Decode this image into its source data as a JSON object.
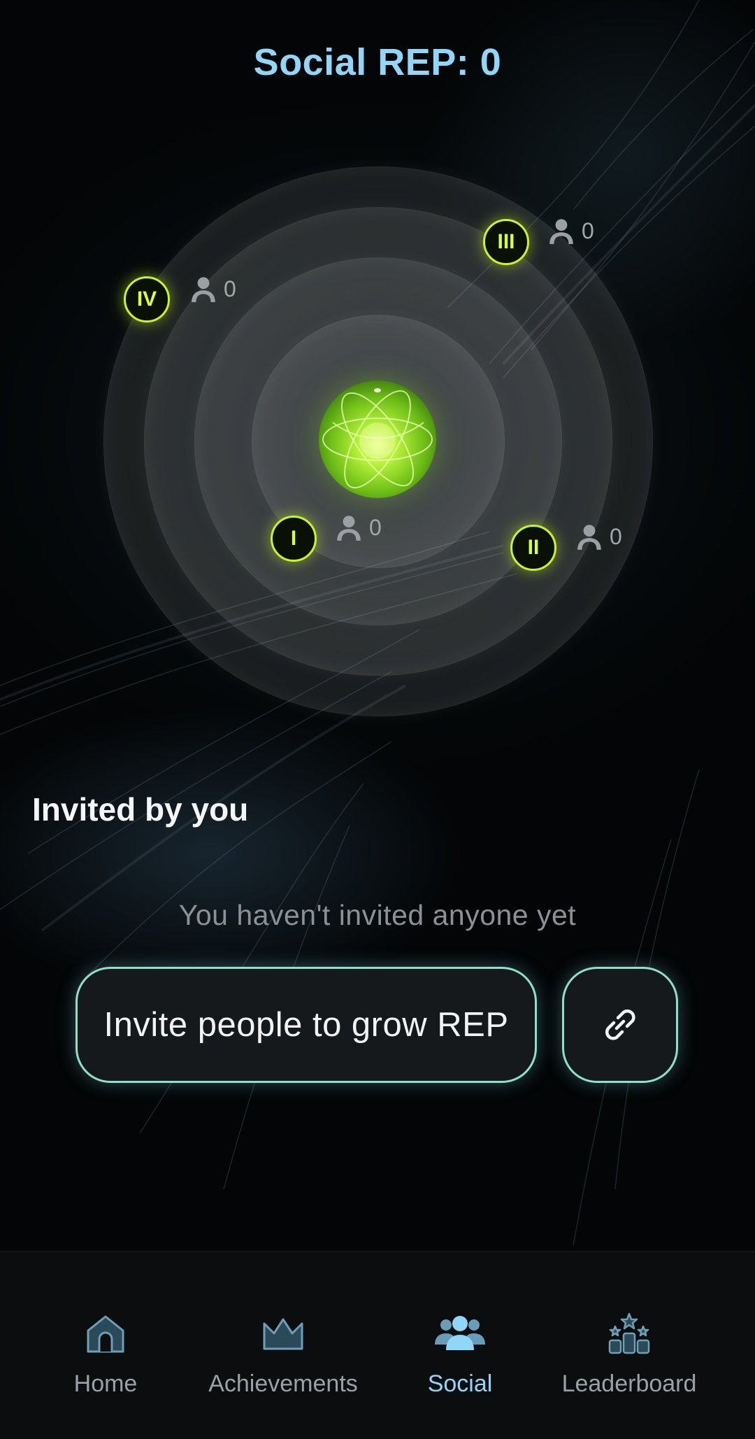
{
  "header": {
    "title": "Social REP: 0"
  },
  "levels": [
    {
      "numeral": "I",
      "count": "0"
    },
    {
      "numeral": "II",
      "count": "0"
    },
    {
      "numeral": "III",
      "count": "0"
    },
    {
      "numeral": "IV",
      "count": "0"
    }
  ],
  "invited": {
    "title": "Invited by you",
    "empty_text": "You haven't invited anyone yet",
    "invite_label": "Invite people to grow REP"
  },
  "nav": {
    "items": [
      {
        "label": "Home",
        "icon": "home-icon"
      },
      {
        "label": "Achievements",
        "icon": "crown-icon"
      },
      {
        "label": "Social",
        "icon": "people-icon",
        "active": true
      },
      {
        "label": "Leaderboard",
        "icon": "podium-icon"
      }
    ]
  },
  "colors": {
    "title": "#8fd6f7",
    "level_accent": "#c9f42a",
    "button_border": "#8fe0c8",
    "active_nav": "#8fd6f7"
  }
}
